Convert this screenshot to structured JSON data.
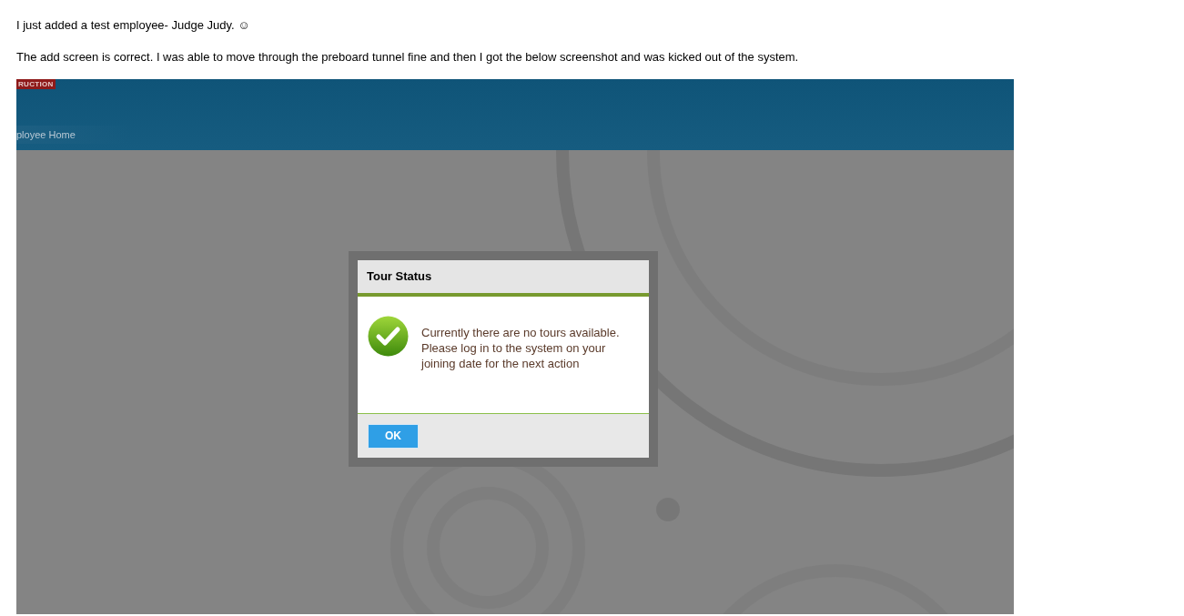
{
  "message": {
    "paragraphs": [
      "I just added a test employee- Judge Judy. ☺",
      "The add screen is correct.  I was able to move through the preboard tunnel fine and then I got the below screenshot and was kicked out of the system."
    ]
  },
  "screenshot": {
    "badge": "RUCTION",
    "nav_label": "ployee Home",
    "dialog": {
      "title": "Tour Status",
      "message": "Currently there are no tours available. Please log in to the system on your joining date for the next action",
      "button": "OK"
    }
  }
}
